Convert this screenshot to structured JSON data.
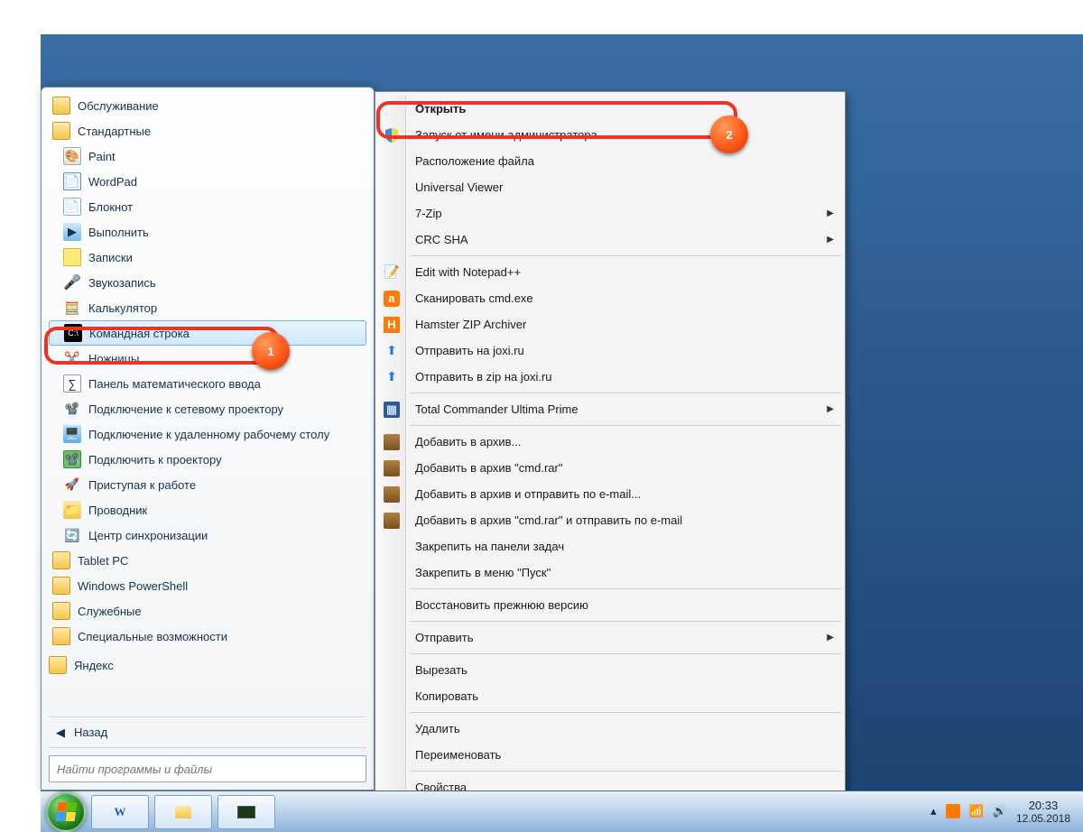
{
  "start_menu": {
    "items": [
      {
        "kind": "folder",
        "label": "Обслуживание"
      },
      {
        "kind": "folder",
        "label": "Стандартные"
      },
      {
        "kind": "app",
        "label": "Paint",
        "icon": "paint-icon"
      },
      {
        "kind": "app",
        "label": "WordPad",
        "icon": "wordpad-icon"
      },
      {
        "kind": "app",
        "label": "Блокнот",
        "icon": "notepad-icon"
      },
      {
        "kind": "app",
        "label": "Выполнить",
        "icon": "run-icon"
      },
      {
        "kind": "app",
        "label": "Записки",
        "icon": "sticky-icon"
      },
      {
        "kind": "app",
        "label": "Звукозапись",
        "icon": "mic-icon"
      },
      {
        "kind": "app",
        "label": "Калькулятор",
        "icon": "calc-icon"
      },
      {
        "kind": "app",
        "label": "Командная строка",
        "icon": "cmd-icon",
        "selected": true
      },
      {
        "kind": "app",
        "label": "Ножницы",
        "icon": "scissors-icon"
      },
      {
        "kind": "app",
        "label": "Панель математического ввода",
        "icon": "math-icon"
      },
      {
        "kind": "app",
        "label": "Подключение к сетевому проектору",
        "icon": "netproj-icon"
      },
      {
        "kind": "app",
        "label": "Подключение к удаленному рабочему столу",
        "icon": "rdp-icon"
      },
      {
        "kind": "app",
        "label": "Подключить к проектору",
        "icon": "proj-icon"
      },
      {
        "kind": "app",
        "label": "Приступая к работе",
        "icon": "getting-started-icon"
      },
      {
        "kind": "app",
        "label": "Проводник",
        "icon": "explorer-icon"
      },
      {
        "kind": "app",
        "label": "Центр синхронизации",
        "icon": "sync-icon"
      },
      {
        "kind": "folder",
        "label": "Tablet PC"
      },
      {
        "kind": "folder",
        "label": "Windows PowerShell"
      },
      {
        "kind": "folder",
        "label": "Служебные"
      },
      {
        "kind": "folder",
        "label": "Специальные возможности"
      },
      {
        "kind": "folder-top",
        "label": "Яндекс"
      }
    ],
    "back_label": "Назад",
    "search_placeholder": "Найти программы и файлы"
  },
  "context_menu": {
    "items": [
      {
        "label": "Открыть",
        "bold": true
      },
      {
        "label": "Запуск от имени администратора",
        "icon": "shield-icon"
      },
      {
        "label": "Расположение файла"
      },
      {
        "label": "Universal Viewer"
      },
      {
        "label": "7-Zip",
        "submenu": true
      },
      {
        "label": "CRC SHA",
        "submenu": true
      },
      {
        "sep": true
      },
      {
        "label": "Edit with Notepad++",
        "icon": "notepadpp-icon"
      },
      {
        "label": "Сканировать cmd.exe",
        "icon": "avast-icon"
      },
      {
        "label": "Hamster ZIP Archiver",
        "icon": "hamster-icon"
      },
      {
        "label": "Отправить на joxi.ru",
        "icon": "joxi-icon"
      },
      {
        "label": "Отправить в zip на joxi.ru",
        "icon": "joxi-icon"
      },
      {
        "sep": true
      },
      {
        "label": "Total Commander Ultima Prime",
        "icon": "tc-icon",
        "submenu": true
      },
      {
        "sep": true
      },
      {
        "label": "Добавить в архив...",
        "icon": "winrar-icon"
      },
      {
        "label": "Добавить в архив \"cmd.rar\"",
        "icon": "winrar-icon"
      },
      {
        "label": "Добавить в архив и отправить по e-mail...",
        "icon": "winrar-icon"
      },
      {
        "label": "Добавить в архив \"cmd.rar\" и отправить по e-mail",
        "icon": "winrar-icon"
      },
      {
        "label": "Закрепить на панели задач"
      },
      {
        "label": "Закрепить в меню \"Пуск\""
      },
      {
        "sep": true
      },
      {
        "label": "Восстановить прежнюю версию"
      },
      {
        "sep": true
      },
      {
        "label": "Отправить",
        "submenu": true
      },
      {
        "sep": true
      },
      {
        "label": "Вырезать"
      },
      {
        "label": "Копировать"
      },
      {
        "sep": true
      },
      {
        "label": "Удалить"
      },
      {
        "label": "Переименовать"
      },
      {
        "sep": true
      },
      {
        "label": "Свойства"
      }
    ]
  },
  "callouts": {
    "badge1": "1",
    "badge2": "2"
  },
  "taskbar": {
    "time": "20:33",
    "date": "12.05.2018"
  }
}
